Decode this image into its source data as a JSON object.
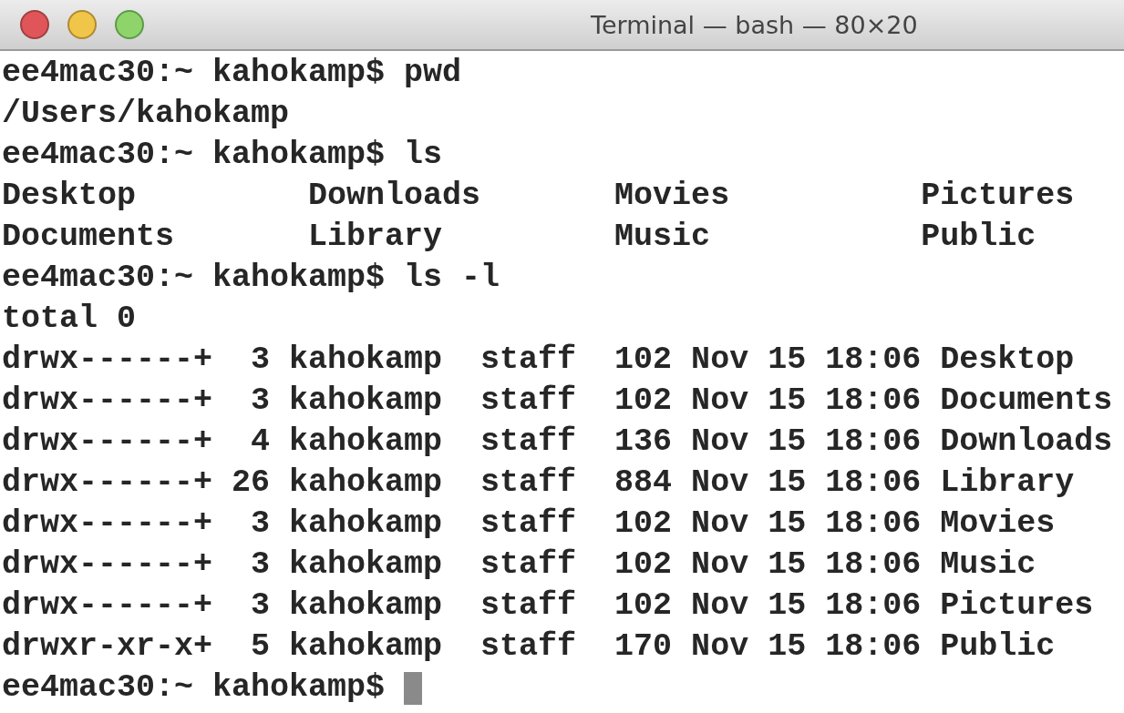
{
  "window": {
    "title": "Terminal — bash — 80×20"
  },
  "lines": [
    "ee4mac30:~ kahokamp$ pwd",
    "/Users/kahokamp",
    "ee4mac30:~ kahokamp$ ls",
    "Desktop         Downloads       Movies          Pictures",
    "Documents       Library         Music           Public",
    "ee4mac30:~ kahokamp$ ls -l",
    "total 0",
    "drwx------+  3 kahokamp  staff  102 Nov 15 18:06 Desktop",
    "drwx------+  3 kahokamp  staff  102 Nov 15 18:06 Documents",
    "drwx------+  4 kahokamp  staff  136 Nov 15 18:06 Downloads",
    "drwx------+ 26 kahokamp  staff  884 Nov 15 18:06 Library",
    "drwx------+  3 kahokamp  staff  102 Nov 15 18:06 Movies",
    "drwx------+  3 kahokamp  staff  102 Nov 15 18:06 Music",
    "drwx------+  3 kahokamp  staff  102 Nov 15 18:06 Pictures",
    "drwxr-xr-x+  5 kahokamp  staff  170 Nov 15 18:06 Public"
  ],
  "prompt": "ee4mac30:~ kahokamp$"
}
